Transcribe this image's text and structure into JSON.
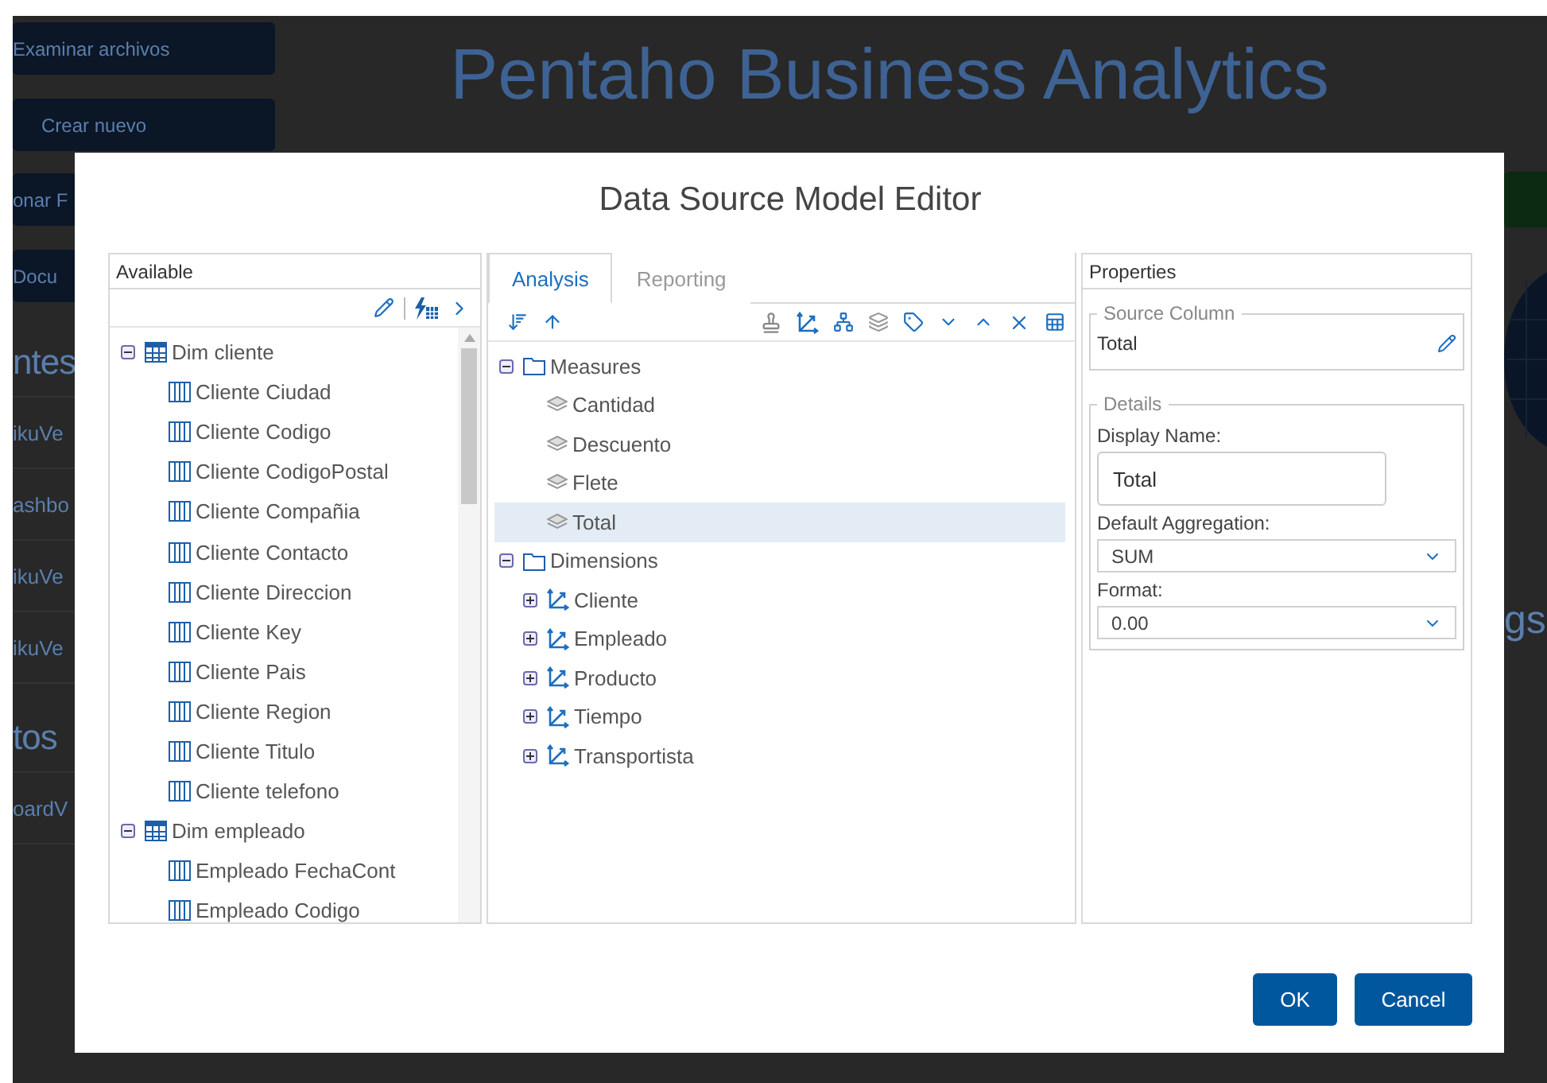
{
  "background": {
    "buttons": [
      {
        "label": "Examinar archivos"
      },
      {
        "label": "Crear nuevo"
      }
    ],
    "title": "Pentaho Business Analytics",
    "side_buttons": [
      {
        "label": "onar F"
      },
      {
        "label": "Docu"
      }
    ],
    "sections": [
      {
        "heading": "ntes",
        "items": [
          "ikuVe",
          "ashbo",
          "ikuVe",
          "ikuVe"
        ]
      },
      {
        "heading": "tos",
        "items": [
          "oardV"
        ]
      }
    ],
    "right_text": "gs"
  },
  "dialog": {
    "title": "Data Source Model Editor",
    "available": {
      "title": "Available",
      "tree": [
        {
          "label": "Dim cliente",
          "kind": "table",
          "expanded": true,
          "selected": false,
          "children": [
            {
              "label": "Cliente Ciudad",
              "kind": "column",
              "selected": false
            },
            {
              "label": "Cliente Codigo",
              "kind": "column",
              "selected": false
            },
            {
              "label": "Cliente CodigoPostal",
              "kind": "column",
              "selected": false
            },
            {
              "label": "Cliente Compañia",
              "kind": "column",
              "selected": false
            },
            {
              "label": "Cliente Contacto",
              "kind": "column",
              "selected": false
            },
            {
              "label": "Cliente Direccion",
              "kind": "column",
              "selected": false
            },
            {
              "label": "Cliente Key",
              "kind": "column",
              "selected": false
            },
            {
              "label": "Cliente Pais",
              "kind": "column",
              "selected": false
            },
            {
              "label": "Cliente Region",
              "kind": "column",
              "selected": false
            },
            {
              "label": "Cliente Titulo",
              "kind": "column",
              "selected": false
            },
            {
              "label": "Cliente telefono",
              "kind": "column",
              "selected": false
            }
          ]
        },
        {
          "label": "Dim empleado",
          "kind": "table",
          "expanded": true,
          "selected": false,
          "children": [
            {
              "label": "Empleado FechaCont",
              "kind": "column",
              "selected": false
            },
            {
              "label": "Empleado Codigo",
              "kind": "column",
              "selected": false
            }
          ]
        }
      ]
    },
    "model": {
      "tabs": [
        {
          "label": "Analysis",
          "selected": true
        },
        {
          "label": "Reporting",
          "selected": false
        }
      ],
      "tree": [
        {
          "label": "Measures",
          "kind": "folder",
          "expanded": true,
          "selected": false,
          "children": [
            {
              "label": "Cantidad",
              "kind": "measure",
              "selected": false
            },
            {
              "label": "Descuento",
              "kind": "measure",
              "selected": false
            },
            {
              "label": "Flete",
              "kind": "measure",
              "selected": false
            },
            {
              "label": "Total",
              "kind": "measure",
              "selected": true
            }
          ]
        },
        {
          "label": "Dimensions",
          "kind": "folder",
          "expanded": true,
          "selected": false,
          "children": [
            {
              "label": "Cliente",
              "kind": "dimension",
              "expanded": false,
              "selected": false
            },
            {
              "label": "Empleado",
              "kind": "dimension",
              "expanded": false,
              "selected": false
            },
            {
              "label": "Producto",
              "kind": "dimension",
              "expanded": false,
              "selected": false
            },
            {
              "label": "Tiempo",
              "kind": "dimension",
              "expanded": false,
              "selected": false
            },
            {
              "label": "Transportista",
              "kind": "dimension",
              "expanded": false,
              "selected": false
            }
          ]
        }
      ]
    },
    "properties": {
      "title": "Properties",
      "source_column": {
        "legend": "Source Column",
        "value": "Total"
      },
      "details": {
        "legend": "Details",
        "fields": [
          {
            "kind": "text",
            "label": "Display Name:",
            "value": "Total"
          },
          {
            "kind": "select",
            "label": "Default Aggregation:",
            "value": "SUM"
          },
          {
            "kind": "select",
            "label": "Format:",
            "value": "0.00"
          }
        ]
      }
    },
    "buttons": [
      {
        "label": "OK"
      },
      {
        "label": "Cancel"
      }
    ]
  }
}
